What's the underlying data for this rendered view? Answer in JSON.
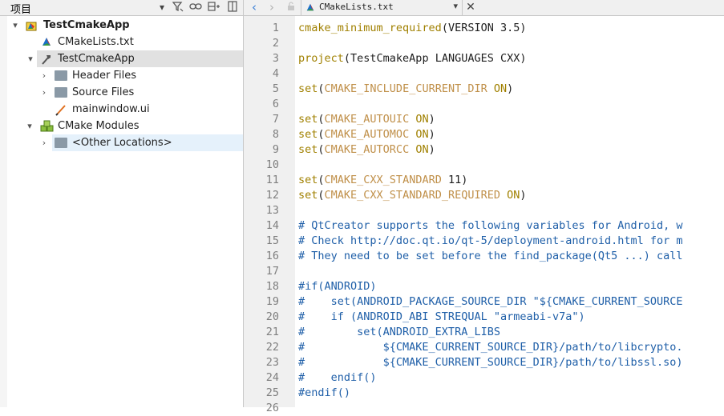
{
  "colors": {
    "keyword": "#a08000",
    "variable": "#c0904a",
    "comment": "#1f5fa8",
    "line_numbers": "#7f7f7f",
    "selection": "#e1e1e1",
    "hover": "#e5f1fb"
  },
  "left_panel": {
    "title": "项目",
    "toolbar_icons": [
      "dropdown-arrow-icon",
      "filter-icon",
      "link-icon",
      "split-icon",
      "close-pane-icon"
    ]
  },
  "tree": [
    {
      "label": "TestCmakeApp",
      "icon": "cmake-project-icon",
      "arrow": "▾",
      "bold": true
    },
    {
      "label": "CMakeLists.txt",
      "icon": "cmake-file-icon",
      "arrow": ""
    },
    {
      "label": "TestCmakeApp",
      "icon": "hammer-icon",
      "arrow": "▾",
      "selected": true
    },
    {
      "label": "Header Files",
      "icon": "folder-icon",
      "arrow": "›"
    },
    {
      "label": "Source Files",
      "icon": "folder-icon",
      "arrow": "›"
    },
    {
      "label": "mainwindow.ui",
      "icon": "ui-file-icon",
      "arrow": ""
    },
    {
      "label": "CMake Modules",
      "icon": "modules-icon",
      "arrow": "▾"
    },
    {
      "label": "<Other Locations>",
      "icon": "folder-icon",
      "arrow": "›",
      "hover": true
    }
  ],
  "editor": {
    "file_name": "CMakeLists.txt",
    "nav": [
      "back-icon",
      "forward-icon",
      "lock-icon"
    ],
    "lines": [
      [
        [
          "kw",
          "cmake_minimum_required"
        ],
        [
          "txt",
          "(VERSION 3.5)"
        ]
      ],
      [],
      [
        [
          "kw",
          "project"
        ],
        [
          "txt",
          "(TestCmakeApp LANGUAGES CXX)"
        ]
      ],
      [],
      [
        [
          "kw",
          "set"
        ],
        [
          "txt",
          "("
        ],
        [
          "var",
          "CMAKE_INCLUDE_CURRENT_DIR"
        ],
        [
          "txt",
          " "
        ],
        [
          "kw",
          "ON"
        ],
        [
          "txt",
          ")"
        ]
      ],
      [],
      [
        [
          "kw",
          "set"
        ],
        [
          "txt",
          "("
        ],
        [
          "var",
          "CMAKE_AUTOUIC"
        ],
        [
          "txt",
          " "
        ],
        [
          "kw",
          "ON"
        ],
        [
          "txt",
          ")"
        ]
      ],
      [
        [
          "kw",
          "set"
        ],
        [
          "txt",
          "("
        ],
        [
          "var",
          "CMAKE_AUTOMOC"
        ],
        [
          "txt",
          " "
        ],
        [
          "kw",
          "ON"
        ],
        [
          "txt",
          ")"
        ]
      ],
      [
        [
          "kw",
          "set"
        ],
        [
          "txt",
          "("
        ],
        [
          "var",
          "CMAKE_AUTORCC"
        ],
        [
          "txt",
          " "
        ],
        [
          "kw",
          "ON"
        ],
        [
          "txt",
          ")"
        ]
      ],
      [],
      [
        [
          "kw",
          "set"
        ],
        [
          "txt",
          "("
        ],
        [
          "var",
          "CMAKE_CXX_STANDARD"
        ],
        [
          "txt",
          " 11)"
        ]
      ],
      [
        [
          "kw",
          "set"
        ],
        [
          "txt",
          "("
        ],
        [
          "var",
          "CMAKE_CXX_STANDARD_REQUIRED"
        ],
        [
          "txt",
          " "
        ],
        [
          "kw",
          "ON"
        ],
        [
          "txt",
          ")"
        ]
      ],
      [],
      [
        [
          "cmt",
          "# QtCreator supports the following variables for Android, w"
        ]
      ],
      [
        [
          "cmt",
          "# Check http://doc.qt.io/qt-5/deployment-android.html for m"
        ]
      ],
      [
        [
          "cmt",
          "# They need to be set before the find_package(Qt5 ...) call"
        ]
      ],
      [],
      [
        [
          "cmt",
          "#if(ANDROID)"
        ]
      ],
      [
        [
          "cmt",
          "#    set(ANDROID_PACKAGE_SOURCE_DIR \"${CMAKE_CURRENT_SOURCE"
        ]
      ],
      [
        [
          "cmt",
          "#    if (ANDROID_ABI STREQUAL \"armeabi-v7a\")"
        ]
      ],
      [
        [
          "cmt",
          "#        set(ANDROID_EXTRA_LIBS"
        ]
      ],
      [
        [
          "cmt",
          "#            ${CMAKE_CURRENT_SOURCE_DIR}/path/to/libcrypto."
        ]
      ],
      [
        [
          "cmt",
          "#            ${CMAKE_CURRENT_SOURCE_DIR}/path/to/libssl.so)"
        ]
      ],
      [
        [
          "cmt",
          "#    endif()"
        ]
      ],
      [
        [
          "cmt",
          "#endif()"
        ]
      ],
      []
    ],
    "line_numbers": [
      "1",
      "2",
      "3",
      "4",
      "5",
      "6",
      "7",
      "8",
      "9",
      "10",
      "11",
      "12",
      "13",
      "14",
      "15",
      "16",
      "17",
      "18",
      "19",
      "20",
      "21",
      "22",
      "23",
      "24",
      "25",
      "26"
    ]
  }
}
